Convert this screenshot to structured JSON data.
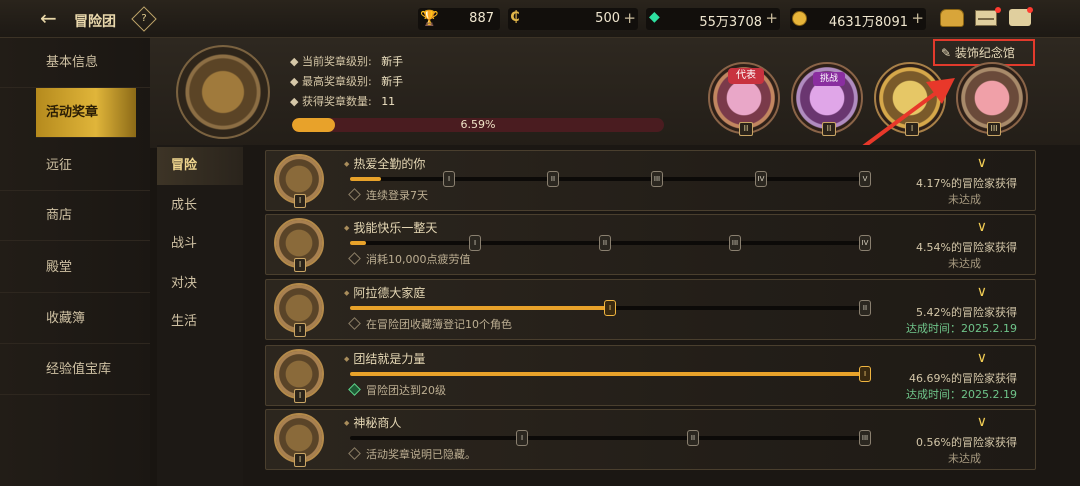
{
  "header": {
    "back_label": "冒险团",
    "help_label": "?"
  },
  "resources": [
    {
      "icon": "trophy-icon",
      "value": "887",
      "plus": false
    },
    {
      "icon": "coin-c-icon",
      "value": "500",
      "plus": true
    },
    {
      "icon": "gem-icon",
      "value": "55万3708",
      "plus": true
    },
    {
      "icon": "gold-icon",
      "value": "4631万8091",
      "plus": true
    }
  ],
  "sidebar": {
    "items": [
      {
        "label": "基本信息"
      },
      {
        "label": "活动奖章"
      },
      {
        "label": "远征"
      },
      {
        "label": "商店"
      },
      {
        "label": "殿堂"
      },
      {
        "label": "收藏簿"
      },
      {
        "label": "经验值宝库"
      }
    ],
    "active_index": 1
  },
  "summary": {
    "current_level_label": "当前奖章级别:",
    "current_level_value": "新手",
    "highest_level_label": "最高奖章级别:",
    "highest_level_value": "新手",
    "count_label": "获得奖章数量:",
    "count_value": "11",
    "progress_text": "6.59%",
    "progress_fraction": 0.0659
  },
  "decor_button": "装饰纪念馆",
  "badges": [
    {
      "tag": "代表",
      "rank": "II",
      "color": "#d24a5a"
    },
    {
      "tag": "挑战",
      "rank": "II",
      "color": "#a24ab0"
    },
    {
      "tag": "",
      "rank": "I",
      "color": "#d8b04a"
    },
    {
      "tag": "",
      "rank": "III",
      "color": "#b0554a"
    }
  ],
  "subnav": {
    "items": [
      "冒险",
      "成长",
      "战斗",
      "对决",
      "生活"
    ],
    "active_index": 0
  },
  "achievements": [
    {
      "title": "热爱全勤的你",
      "desc": "连续登录7天",
      "done": false,
      "rank": "I",
      "pct": "4.17%的冒险家获得",
      "status": "未达成",
      "progress": 0.06,
      "nodes": [
        {
          "label": "I",
          "pos": 0.19
        },
        {
          "label": "II",
          "pos": 0.39
        },
        {
          "label": "III",
          "pos": 0.59
        },
        {
          "label": "IV",
          "pos": 0.79
        },
        {
          "label": "V",
          "pos": 0.99
        }
      ]
    },
    {
      "title": "我能快乐一整天",
      "desc": "消耗10,000点疲劳值",
      "done": false,
      "rank": "I",
      "pct": "4.54%的冒险家获得",
      "status": "未达成",
      "progress": 0.03,
      "nodes": [
        {
          "label": "I",
          "pos": 0.24
        },
        {
          "label": "II",
          "pos": 0.49
        },
        {
          "label": "III",
          "pos": 0.74
        },
        {
          "label": "IV",
          "pos": 0.99
        }
      ]
    },
    {
      "title": "阿拉德大家庭",
      "desc": "在冒险团收藏簿登记10个角色",
      "done": false,
      "rank": "I",
      "pct": "5.42%的冒险家获得",
      "status": "达成时间：2025.2.19",
      "progress": 0.5,
      "nodes": [
        {
          "label": "I",
          "pos": 0.5,
          "gold": true
        },
        {
          "label": "II",
          "pos": 0.99
        }
      ]
    },
    {
      "title": "团结就是力量",
      "desc": "冒险团达到20级",
      "done": true,
      "rank": "I",
      "pct": "46.69%的冒险家获得",
      "status": "达成时间：2025.2.19",
      "progress": 1.0,
      "nodes": [
        {
          "label": "I",
          "pos": 0.99,
          "gold": true
        }
      ]
    },
    {
      "title": "神秘商人",
      "desc": "活动奖章说明已隐藏。",
      "done": false,
      "rank": "I",
      "pct": "0.56%的冒险家获得",
      "status": "未达成",
      "progress": 0.0,
      "nodes": [
        {
          "label": "I",
          "pos": 0.33
        },
        {
          "label": "II",
          "pos": 0.66
        },
        {
          "label": "III",
          "pos": 0.99
        }
      ]
    }
  ]
}
